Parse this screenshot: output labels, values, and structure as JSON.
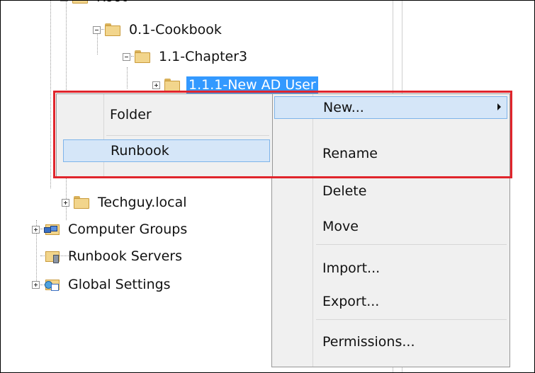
{
  "tree": {
    "root_label": "Root",
    "cookbook_label": "0.1-Cookbook",
    "chapter_label": "1.1-Chapter3",
    "selected_label": "1.1.1-New AD User",
    "techguy_label": "Techguy.local",
    "computer_groups_label": "Computer Groups",
    "runbook_servers_label": "Runbook Servers",
    "global_settings_label": "Global Settings"
  },
  "menu": {
    "new_submenu": {
      "folder_label": "Folder",
      "runbook_label": "Runbook"
    },
    "items": {
      "new": "New...",
      "rename": "Rename",
      "delete": "Delete",
      "move": "Move",
      "import": "Import...",
      "export": "Export...",
      "permissions": "Permissions..."
    }
  },
  "colors": {
    "selection": "#3399ff",
    "menu_highlight": "#d5e6f8",
    "callout": "#e0252c"
  }
}
